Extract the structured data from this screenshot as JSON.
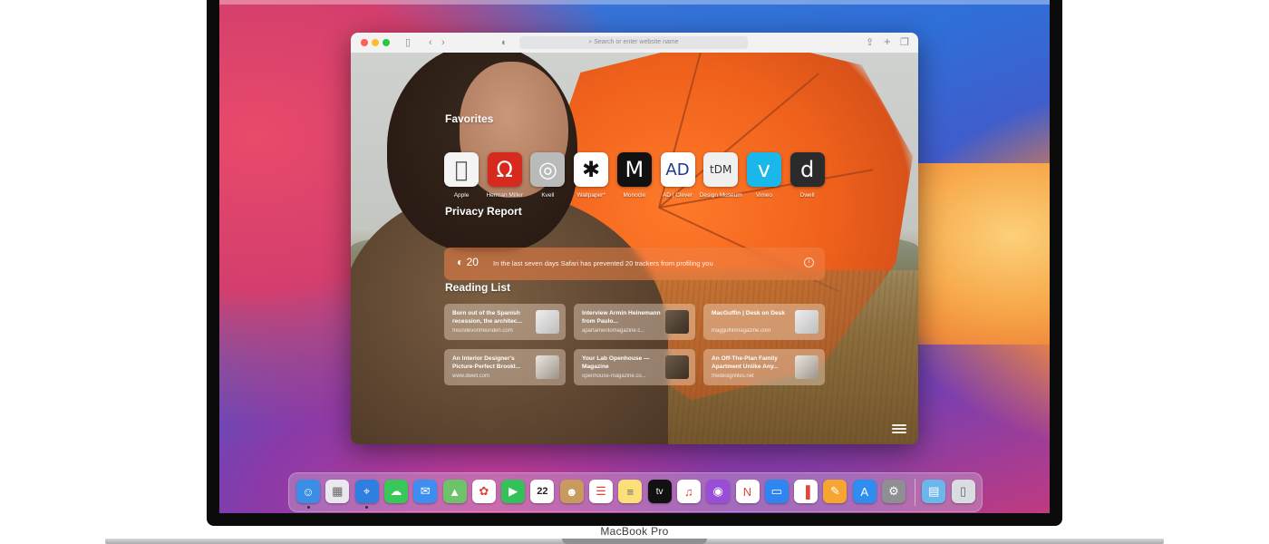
{
  "device": {
    "label": "MacBook Pro"
  },
  "safari": {
    "address_placeholder": "Search or enter website name",
    "favorites": {
      "title": "Favorites",
      "items": [
        {
          "label": "Apple",
          "glyph": "",
          "bg": "#f4f4f4",
          "fg": "#555555"
        },
        {
          "label": "Herman Miller",
          "glyph": "Ω",
          "bg": "#d62a1f",
          "fg": "#ffffff"
        },
        {
          "label": "Kvell",
          "glyph": "◎",
          "bg": "#b9bbba",
          "fg": "#ffffff"
        },
        {
          "label": "Wallpaper*",
          "glyph": "✱",
          "bg": "#ffffff",
          "fg": "#111111"
        },
        {
          "label": "Monocle",
          "glyph": "M",
          "bg": "#111111",
          "fg": "#ffffff"
        },
        {
          "label": "AD | Clever",
          "glyph": "AD",
          "bg": "#ffffff",
          "fg": "#1b3a8c"
        },
        {
          "label": "Design Museum",
          "glyph": "tDM",
          "bg": "#f0f0f0",
          "fg": "#333333"
        },
        {
          "label": "Vimeo",
          "glyph": "v",
          "bg": "#1ab7ea",
          "fg": "#ffffff"
        },
        {
          "label": "Dwell",
          "glyph": "d",
          "bg": "#2b2b2b",
          "fg": "#ffffff"
        }
      ]
    },
    "privacy": {
      "title": "Privacy Report",
      "count": "20",
      "message": "In the last seven days Safari has prevented 20 trackers from profiling you"
    },
    "reading_list": {
      "title": "Reading List",
      "items": [
        {
          "title": "Born out of the Spanish recession, the architec...",
          "url": "freundevonfreunden.com"
        },
        {
          "title": "Interview Armin Heinemann from Paulo...",
          "url": "apartamentomagazine.c..."
        },
        {
          "title": "MacGuffin | Desk on Desk",
          "url": "magguffinmagazine.com"
        },
        {
          "title": "An Interior Designer's Picture-Perfect Brookl...",
          "url": "www.dwell.com"
        },
        {
          "title": "Your Lab Openhouse — Magazine",
          "url": "openhouse-magazine.co..."
        },
        {
          "title": "An Off-The-Plan Family Apartment Unlike Any...",
          "url": "thedesignfiles.net"
        }
      ]
    }
  },
  "dock": {
    "apps": [
      {
        "name": "Finder",
        "glyph": "☺",
        "bg": "#3a8ee6"
      },
      {
        "name": "Launchpad",
        "glyph": "▦",
        "bg": "#e8e8ee"
      },
      {
        "name": "Safari",
        "glyph": "⌖",
        "bg": "#2f7fe0"
      },
      {
        "name": "Messages",
        "glyph": "☁",
        "bg": "#38c759"
      },
      {
        "name": "Mail",
        "glyph": "✉",
        "bg": "#3d8ef0"
      },
      {
        "name": "Maps",
        "glyph": "▲",
        "bg": "#6cc36a"
      },
      {
        "name": "Photos",
        "glyph": "✿",
        "bg": "#ffffff"
      },
      {
        "name": "FaceTime",
        "glyph": "▶",
        "bg": "#35c15a"
      },
      {
        "name": "Calendar",
        "glyph": "22",
        "bg": "#ffffff"
      },
      {
        "name": "Contacts",
        "glyph": "☻",
        "bg": "#c79a5e"
      },
      {
        "name": "Reminders",
        "glyph": "☰",
        "bg": "#ffffff"
      },
      {
        "name": "Notes",
        "glyph": "≡",
        "bg": "#fbe07a"
      },
      {
        "name": "Apple TV",
        "glyph": "tv",
        "bg": "#111111"
      },
      {
        "name": "Music",
        "glyph": "♫",
        "bg": "#ffffff"
      },
      {
        "name": "Podcasts",
        "glyph": "◉",
        "bg": "#9a4ed8"
      },
      {
        "name": "News",
        "glyph": "N",
        "bg": "#ffffff"
      },
      {
        "name": "Keynote",
        "glyph": "▭",
        "bg": "#2f86f0"
      },
      {
        "name": "Numbers",
        "glyph": "▐",
        "bg": "#ffffff"
      },
      {
        "name": "Pages",
        "glyph": "✎",
        "bg": "#f7a531"
      },
      {
        "name": "App Store",
        "glyph": "A",
        "bg": "#2f8df0"
      },
      {
        "name": "System Preferences",
        "glyph": "⚙",
        "bg": "#8e8e93"
      },
      {
        "name": "Downloads Folder",
        "glyph": "▤",
        "bg": "#6bb7ec"
      },
      {
        "name": "Trash",
        "glyph": "▯",
        "bg": "#d9dce0"
      }
    ]
  }
}
